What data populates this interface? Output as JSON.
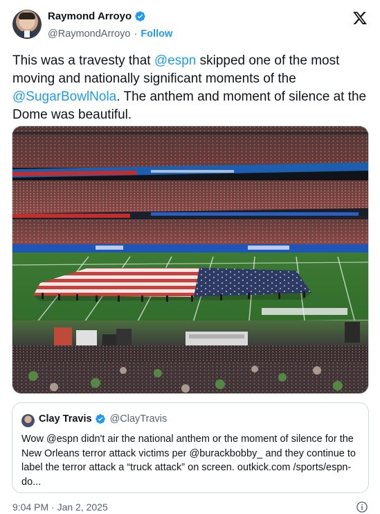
{
  "author": {
    "display_name": "Raymond Arroyo",
    "handle": "@RaymondArroyo",
    "separator": "·",
    "follow_label": "Follow"
  },
  "tweet": {
    "text_parts": [
      "This was a travesty that ",
      "@espn",
      " skipped one of the most moving and nationally significant moments of the ",
      "@SugarBowlNola",
      ".  The anthem and moment of silence at the Dome was beautiful."
    ]
  },
  "quote": {
    "display_name": "Clay Travis",
    "handle": "@ClayTravis",
    "text": "Wow @espn didn't air the national anthem or the moment of silence for the New Orleans terror attack victims per @burackbobby_  and they continue to label the terror attack a “truck attack” on screen. outkick.com /sports/espn-do..."
  },
  "footer": {
    "timestamp": "9:04 PM · Jan 2, 2025"
  },
  "icons": {
    "verified": "verified-badge-icon",
    "platform": "x-logo-icon",
    "info": "info-icon"
  },
  "colors": {
    "accent": "#1d9bf0",
    "text": "#0f1419",
    "secondary": "#536471",
    "border": "#cfd9de"
  }
}
